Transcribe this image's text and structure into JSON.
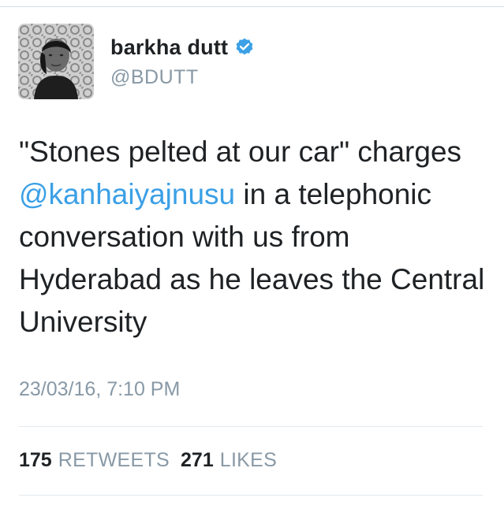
{
  "tweet": {
    "author": {
      "display_name": "barkha dutt",
      "handle": "@BDUTT",
      "verified": true,
      "avatar_icon": "profile-photo-avatar",
      "verified_icon": "verified-badge-icon"
    },
    "text_before_mention": "\"Stones pelted at our car\" charges ",
    "mention": "@kanhaiyajnusu",
    "text_after_mention": " in a telephonic conversation with us from Hyderabad as he leaves the Central University",
    "timestamp": "23/03/16, 7:10 PM",
    "stats": {
      "retweets_count": "175",
      "retweets_label": "RETWEETS",
      "likes_count": "271",
      "likes_label": "LIKES"
    }
  },
  "colors": {
    "mention": "#3ba0e6",
    "verified_badge": "#3ba0e6",
    "secondary_text": "#8899a6",
    "primary_text": "#1f2225"
  }
}
